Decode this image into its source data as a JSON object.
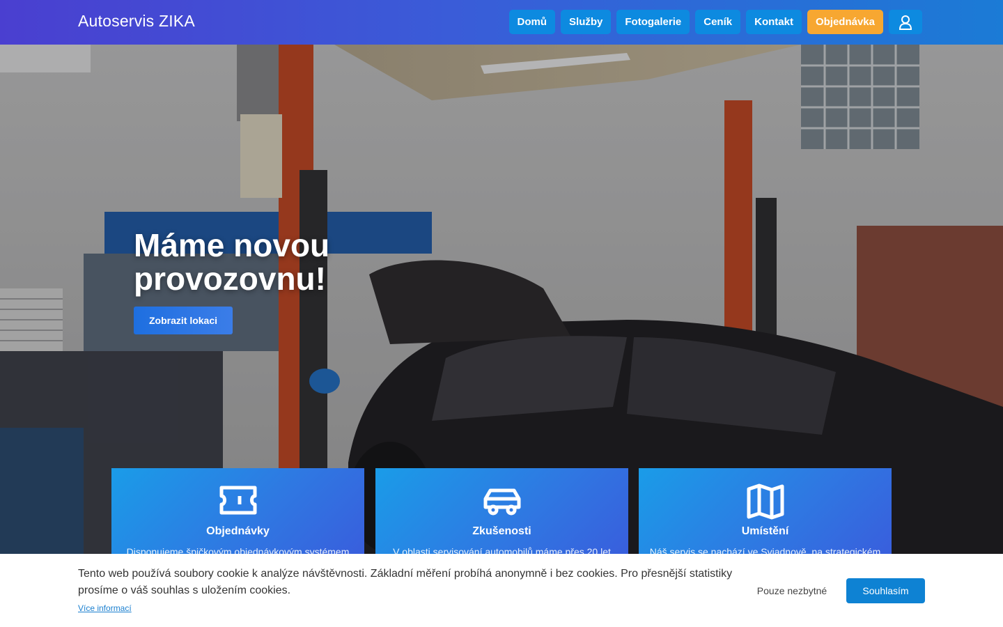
{
  "header": {
    "brand": "Autoservis ZIKA",
    "nav": [
      {
        "label": "Domů"
      },
      {
        "label": "Služby"
      },
      {
        "label": "Fotogalerie"
      },
      {
        "label": "Ceník"
      },
      {
        "label": "Kontakt"
      },
      {
        "label": "Objednávka"
      }
    ],
    "user_icon": "user-icon"
  },
  "hero": {
    "title": "Máme novou provozovnu!",
    "cta_label": "Zobrazit lokaci"
  },
  "cards": [
    {
      "icon": "ticket-icon",
      "title": "Objednávky",
      "text": "Disponujeme špičkovým objednávkovým systémem"
    },
    {
      "icon": "car-icon",
      "title": "Zkušenosti",
      "text": "V oblasti servisování automobilů máme přes 20 let"
    },
    {
      "icon": "map-icon",
      "title": "Umístění",
      "text": "Náš servis se nachází ve Sviadnově, na strategickém"
    }
  ],
  "cookie": {
    "text": "Tento web používá soubory cookie k analýze návštěvnosti. Základní měření probíhá anonymně i bez cookies. Pro přesnější statistiky prosíme o váš souhlas s uložením cookies.",
    "more_label": "Více informací",
    "essential_label": "Pouze nezbytné",
    "accept_label": "Souhlasím"
  },
  "colors": {
    "header_start": "#4a3fd0",
    "header_end": "#1b7bd6",
    "nav_button": "#0d8ae0",
    "order_button": "#f7a731",
    "accept_button": "#0e82d3"
  }
}
